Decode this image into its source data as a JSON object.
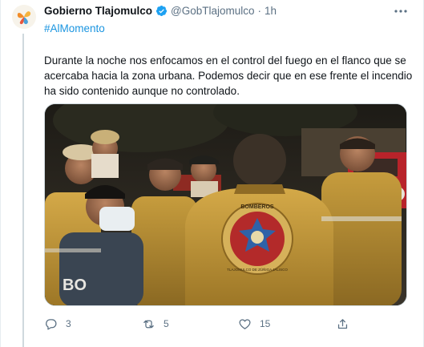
{
  "tweet": {
    "author_name": "Gobierno Tlajomulco",
    "handle": "@GobTlajomulco",
    "separator": "·",
    "time": "1h",
    "hashtag": "#AlMomento",
    "text": "Durante la noche nos enfocamos en el control del fuego en el flanco que se acercaba hacia la zona urbana. Podemos decir que en ese frente el incendio ha sido contenido aunque no controlado.",
    "badge_text": "BOMBEROS",
    "badge_sub": "TLAJOMULCO DE ZÚÑIGA JALISCO",
    "shirt_text": "BO"
  },
  "actions": {
    "reply_count": "3",
    "retweet_count": "5",
    "like_count": "15"
  },
  "icons": {
    "reply": "reply-icon",
    "retweet": "retweet-icon",
    "like": "heart-icon",
    "share": "share-icon",
    "more": "more-icon",
    "verified": "verified-badge-icon"
  },
  "colors": {
    "link": "#1b95e0",
    "verified": "#1da1f2",
    "muted": "#5b7083",
    "jacket": "#c59a3c"
  }
}
